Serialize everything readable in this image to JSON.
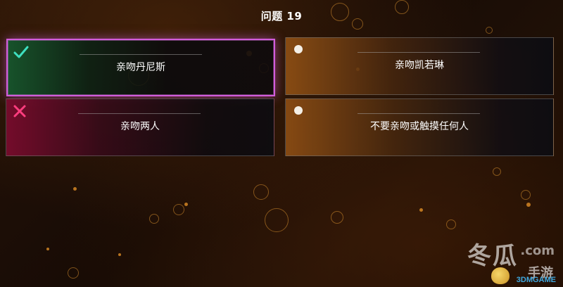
{
  "header": {
    "title": "问题 19"
  },
  "options": [
    {
      "label": "亲吻丹尼斯",
      "state": "correct",
      "indicator": "check-icon",
      "accent": "#d25cdc",
      "indicator_color": "#3fe0c0"
    },
    {
      "label": "亲吻凯若琳",
      "state": "neutral",
      "indicator": "dot-icon"
    },
    {
      "label": "亲吻两人",
      "state": "wrong",
      "indicator": "cross-icon",
      "indicator_color": "#ff3d7f"
    },
    {
      "label": "不要亲吻或触摸任何人",
      "state": "neutral",
      "indicator": "dot-icon"
    }
  ],
  "watermark": {
    "main": "冬瓜",
    "suffix": ".com",
    "sub": "手游",
    "brand": "3DMGAME"
  }
}
